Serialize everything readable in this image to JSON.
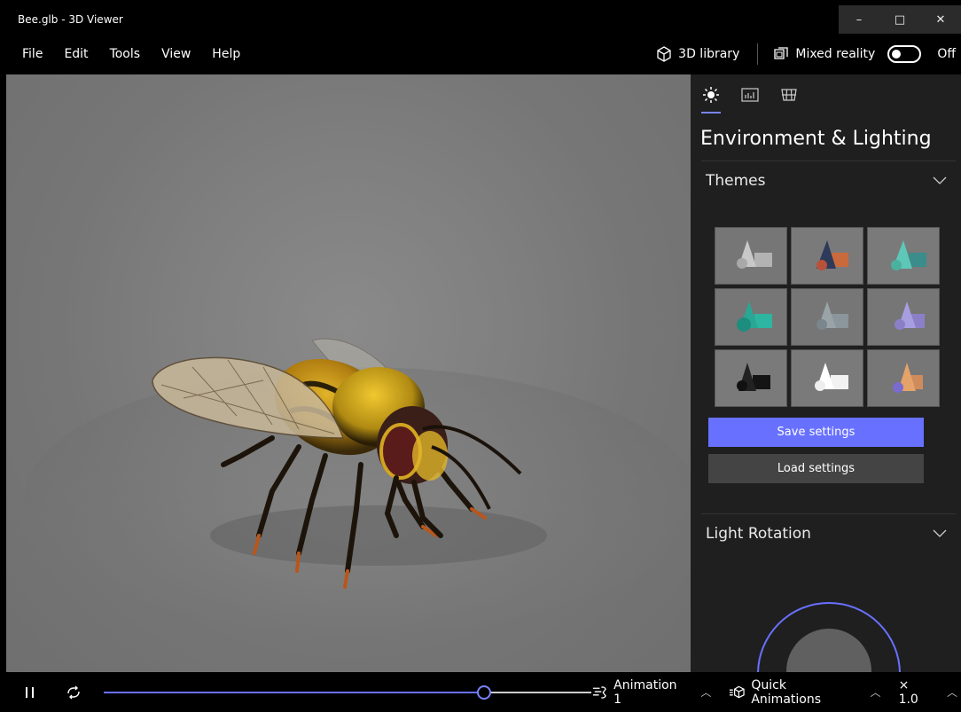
{
  "window": {
    "title": "Bee.glb - 3D Viewer",
    "minimize": "–",
    "maximize": "□",
    "close": "✕"
  },
  "menu": [
    "File",
    "Edit",
    "Tools",
    "View",
    "Help"
  ],
  "toolbar": {
    "library_label": "3D library",
    "mixed_reality_label": "Mixed reality",
    "toggle_state": "Off"
  },
  "panel": {
    "tabs": [
      "environment-tab",
      "stats-tab",
      "grid-tab"
    ],
    "title": "Environment & Lighting",
    "themes_label": "Themes",
    "save_label": "Save settings",
    "load_label": "Load settings",
    "light_rotation_label": "Light Rotation"
  },
  "bottom": {
    "animation_label": "Animation 1",
    "quick_label": "Quick Animations",
    "speed_label": "× 1.0",
    "progress": 0.78
  },
  "colors": {
    "accent": "#6871ff",
    "panel_bg": "#1f1f1f"
  }
}
